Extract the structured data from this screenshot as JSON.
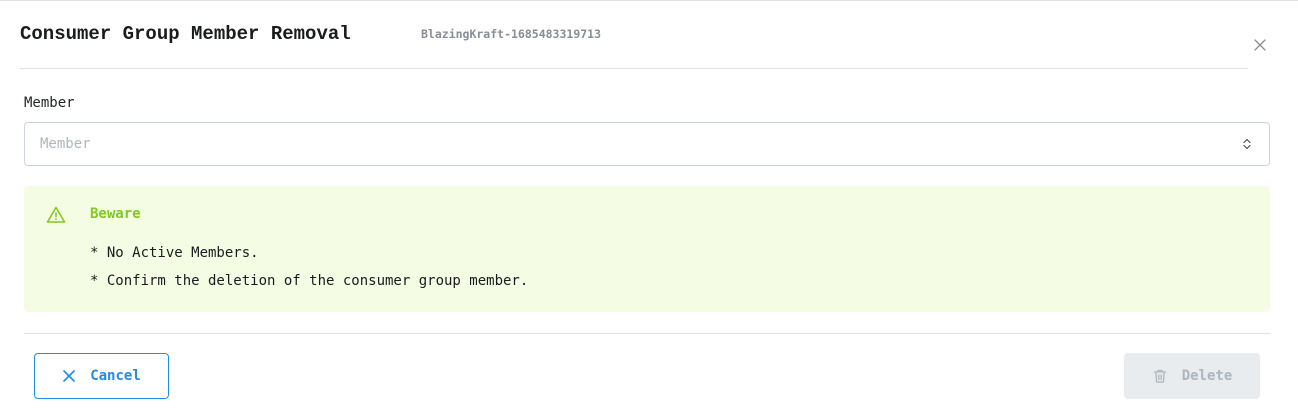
{
  "modal": {
    "title": "Consumer Group Member Removal",
    "subtitle": "BlazingKraft-1685483319713",
    "close_icon": "close-icon"
  },
  "form": {
    "member_label": "Member",
    "member_placeholder": "Member",
    "member_value": "",
    "chevron_icon": "selector-chevron-icon"
  },
  "alert": {
    "icon": "alert-triangle-icon",
    "title": "Beware",
    "lines": [
      "* No Active Members.",
      "* Confirm the deletion of the consumer group member."
    ],
    "colors": {
      "background": "#f4fce3",
      "accent": "#82c91e"
    }
  },
  "footer": {
    "cancel_label": "Cancel",
    "cancel_icon": "x-icon",
    "delete_label": "Delete",
    "delete_icon": "trash-icon",
    "delete_disabled": true
  },
  "colors": {
    "primary": "#228be6",
    "disabled_bg": "#e9ecef",
    "disabled_text": "#adb5bd"
  }
}
